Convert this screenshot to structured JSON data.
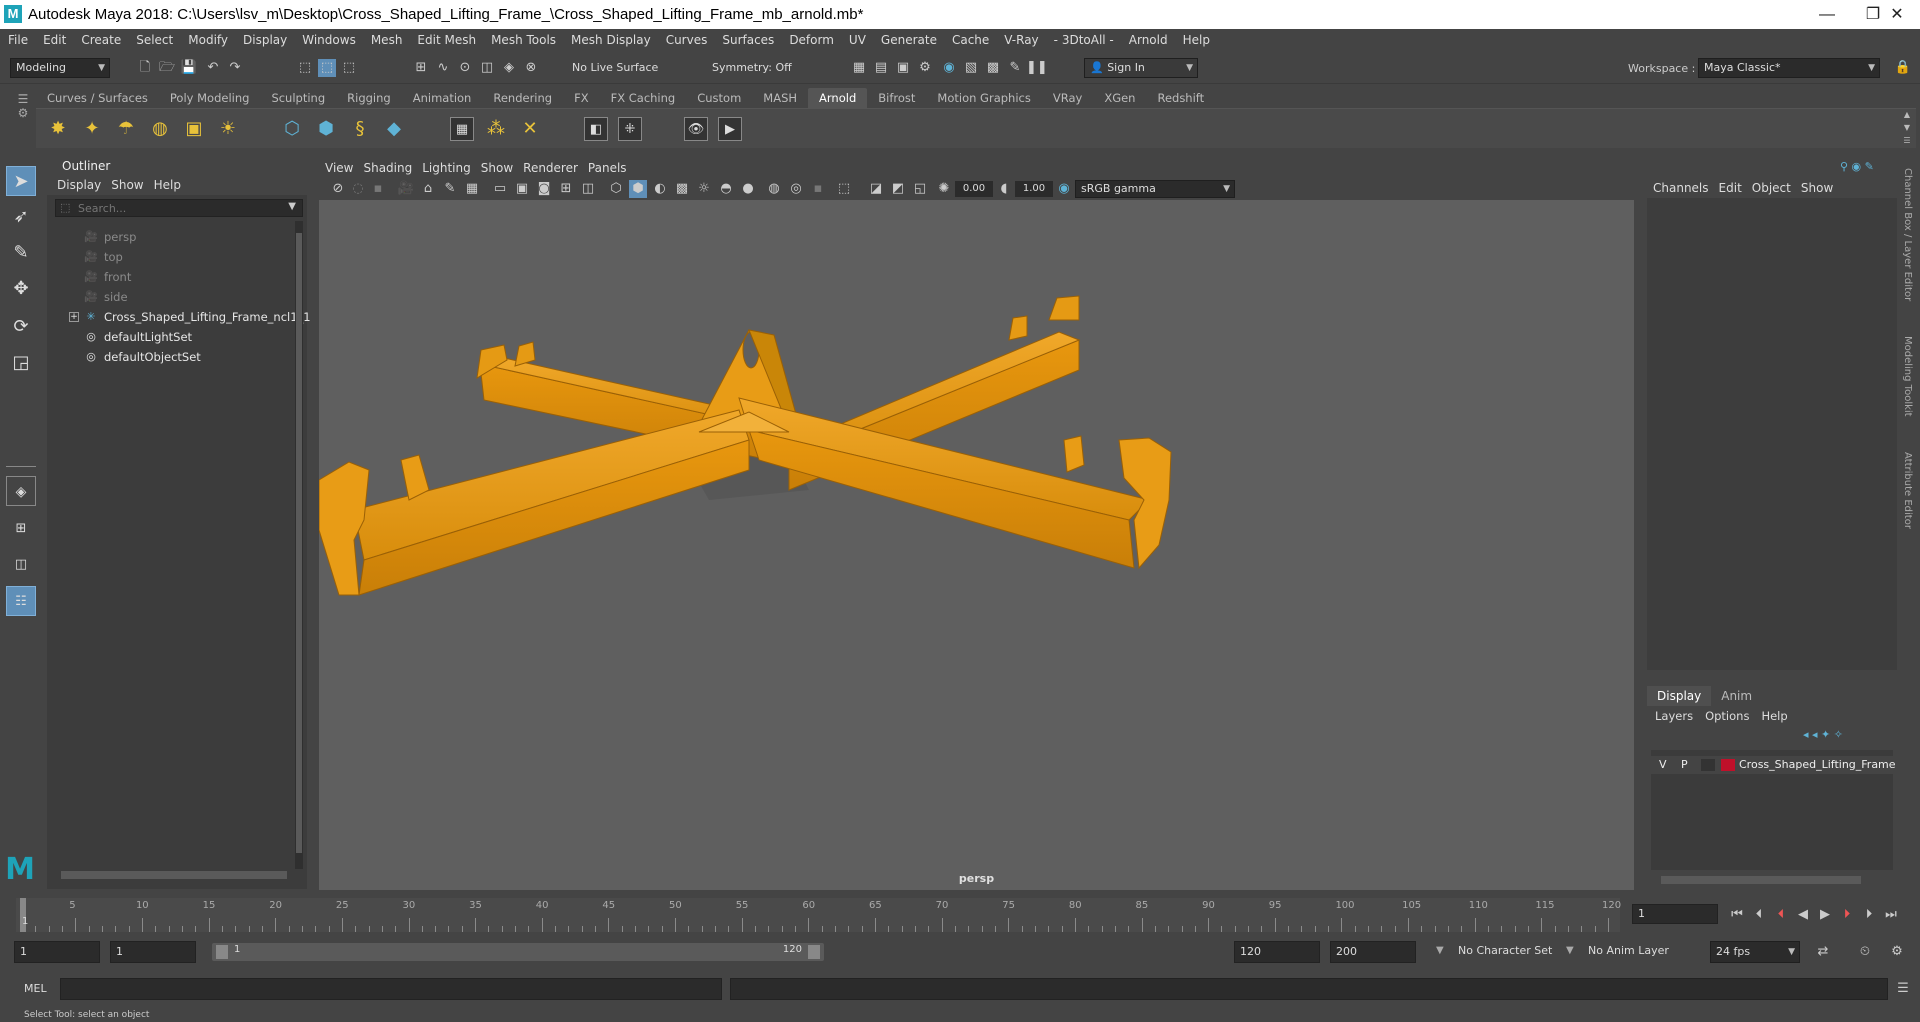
{
  "window": {
    "title": "Autodesk Maya 2018: C:\\Users\\lsv_m\\Desktop\\Cross_Shaped_Lifting_Frame_\\Cross_Shaped_Lifting_Frame_mb_arnold.mb*",
    "logo": "M"
  },
  "menubar": [
    "File",
    "Edit",
    "Create",
    "Select",
    "Modify",
    "Display",
    "Windows",
    "Mesh",
    "Edit Mesh",
    "Mesh Tools",
    "Mesh Display",
    "Curves",
    "Surfaces",
    "Deform",
    "UV",
    "Generate",
    "Cache",
    "V-Ray",
    "- 3DtoAll -",
    "Arnold",
    "Help"
  ],
  "statusline": {
    "mode": "Modeling",
    "live_surface": "No Live Surface",
    "symmetry": "Symmetry: Off",
    "sign_in": "Sign In",
    "workspace_label": "Workspace :",
    "workspace": "Maya Classic*"
  },
  "shelf_tabs": [
    "Curves / Surfaces",
    "Poly Modeling",
    "Sculpting",
    "Rigging",
    "Animation",
    "Rendering",
    "FX",
    "FX Caching",
    "Custom",
    "MASH",
    "Arnold",
    "Bifrost",
    "Motion Graphics",
    "VRay",
    "XGen",
    "Redshift"
  ],
  "shelf_active": "Arnold",
  "outliner": {
    "title": "Outliner",
    "menu": [
      "Display",
      "Show",
      "Help"
    ],
    "search_placeholder": "Search...",
    "items": [
      {
        "label": "persp"
      },
      {
        "label": "top"
      },
      {
        "label": "front"
      },
      {
        "label": "side"
      },
      {
        "label": "Cross_Shaped_Lifting_Frame_ncl1_1"
      },
      {
        "label": "defaultLightSet"
      },
      {
        "label": "defaultObjectSet"
      }
    ]
  },
  "viewport": {
    "menu": [
      "View",
      "Shading",
      "Lighting",
      "Show",
      "Renderer",
      "Panels"
    ],
    "exposure": "0.00",
    "gamma": "1.00",
    "colorspace": "sRGB gamma",
    "camera": "persp",
    "model_color": "#e39a11"
  },
  "channelbox": {
    "menu": [
      "Channels",
      "Edit",
      "Object",
      "Show"
    ]
  },
  "layers": {
    "tabs": [
      "Display",
      "Anim"
    ],
    "menu": [
      "Layers",
      "Options",
      "Help"
    ],
    "row": {
      "v": "V",
      "p": "P",
      "name": "Cross_Shaped_Lifting_Frame",
      "color": "#c0102a"
    }
  },
  "right_strip": [
    "Channel Box / Layer Editor",
    "Modeling Toolkit",
    "Attribute Editor"
  ],
  "timeline": {
    "ticks": [
      "5",
      "10",
      "15",
      "20",
      "25",
      "30",
      "35",
      "40",
      "45",
      "50",
      "55",
      "60",
      "65",
      "70",
      "75",
      "80",
      "85",
      "90",
      "95",
      "100",
      "105",
      "110",
      "115",
      "120"
    ],
    "start_mark": "1",
    "current_frame": "1"
  },
  "range": {
    "start": "1",
    "playback_start": "1",
    "slider_start": "1",
    "slider_end": "120",
    "playback_end": "120",
    "end": "200",
    "character_set": "No Character Set",
    "anim_layer": "No Anim Layer",
    "fps": "24 fps"
  },
  "cmdline": {
    "label": "MEL"
  },
  "helpline": "Select Tool: select an object"
}
